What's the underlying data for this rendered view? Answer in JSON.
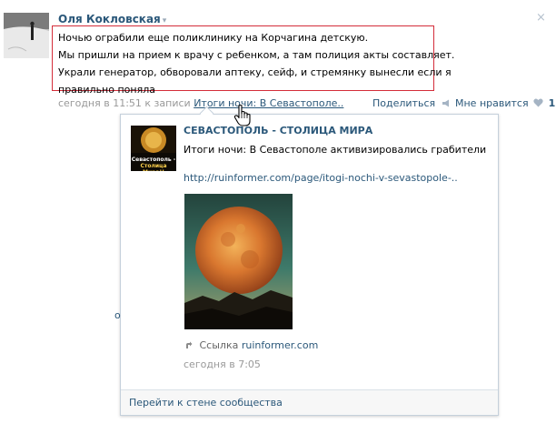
{
  "post": {
    "author": "Оля Кокловская",
    "caret": "▾",
    "close": "×",
    "lines": [
      "Ночью ограбили еще поликлинику на Корчагина детскую.",
      "Мы пришли на прием к врачу с ребенком, а там полиция акты составляет.",
      "Украли генератор, обворовали аптеку, сейф, и стремянку вынесли если я",
      "правильно поняла"
    ],
    "meta_prefix": "сегодня в 11:51 к записи",
    "meta_link": "Итоги ночи: В Севастополе..",
    "share": "Поделиться",
    "like": "Мне нравится",
    "like_count": "1"
  },
  "popup": {
    "group_name": "СЕВАСТОПОЛЬ - СТОЛИЦА МИРА",
    "avatar_line1": "Севастополь -",
    "avatar_line2": "Столица Мира!!",
    "text": "Итоги ночи: В Севастополе активизировались грабители",
    "url": "http://ruinformer.com/page/itogi-nochi-v-sevastopole-..",
    "link_label": "Ссылка",
    "link_domain": "ruinformer.com",
    "time": "сегодня в 7:05",
    "footer": "Перейти к стене сообщества"
  },
  "side_letter": "о",
  "icons": {
    "share_icon": "megaphone-icon",
    "like_icon": "heart-icon",
    "link_icon": "link-arrow-icon",
    "cursor_icon": "hand-cursor-icon"
  },
  "colors": {
    "link": "#2b587a",
    "highlight_border": "#d42d3a",
    "muted": "#999999",
    "popup_border": "#c5d0db"
  }
}
